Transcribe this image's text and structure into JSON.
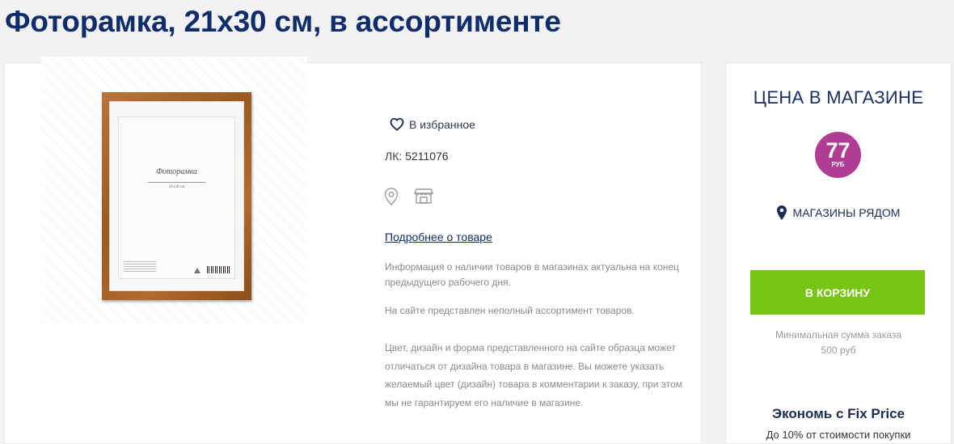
{
  "product": {
    "title": "Фоторамка, 21х30 см, в ассортименте",
    "image": {
      "frame_caption": "Фоторамка",
      "frame_size": "21x30 см"
    },
    "favorite_label": "В избранное",
    "lk_label": "ЛК:",
    "lk_value": "5211076",
    "icons": [
      "map-pin-icon",
      "store-icon"
    ],
    "more_link": "Подробнее о товаре",
    "info_1": "Информация о наличии товаров в магазинах актуальна на конец предыдущего рабочего дня.",
    "info_2": "На сайте представлен неполный ассортимент товаров.",
    "info_3": "Цвет, дизайн и форма представленного на сайте образца может отличаться от дизайна товара в магазине. Вы можете указать желаемый цвет (дизайн) товара в комментарии к заказу, при этом мы не гарантируем его наличие в магазине."
  },
  "price_panel": {
    "title": "ЦЕНА В МАГАЗИНЕ",
    "price": "77",
    "currency": "РУБ",
    "stores_label": "МАГАЗИНЫ РЯДОМ",
    "cart_button": "В КОРЗИНУ",
    "min_order_line1": "Минимальная сумма заказа",
    "min_order_line2": "500 руб",
    "save_title": "Экономь с Fix Price",
    "save_sub": "До 10% от стоимости покупки"
  },
  "colors": {
    "title": "#0f2d6b",
    "price_badge": "#b03c93",
    "cart_button": "#78c414",
    "background": "#f2f2f2"
  }
}
